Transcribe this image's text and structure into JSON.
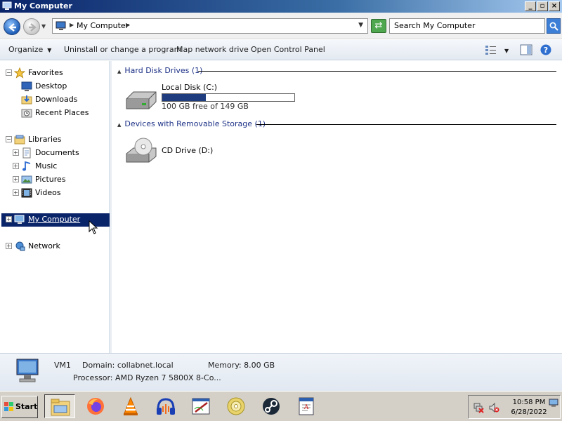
{
  "window": {
    "title": "My Computer"
  },
  "address_bar": {
    "path": "My Computer",
    "search_placeholder": "Search My Computer"
  },
  "toolbar": {
    "organize": "Organize",
    "uninstall": "Uninstall or change a program",
    "map_drive": "Map network drive",
    "control_panel": "Open Control Panel"
  },
  "nav": {
    "favorites": {
      "label": "Favorites",
      "items": [
        "Desktop",
        "Downloads",
        "Recent Places"
      ]
    },
    "libraries": {
      "label": "Libraries",
      "items": [
        "Documents",
        "Music",
        "Pictures",
        "Videos"
      ]
    },
    "my_computer": "My Computer",
    "network": "Network"
  },
  "content": {
    "groups": [
      {
        "header": "Hard Disk Drives (1)",
        "drives": [
          {
            "name": "Local Disk (C:)",
            "free_text": "100 GB free of 149 GB",
            "used_fraction": 0.33
          }
        ]
      },
      {
        "header": "Devices with Removable Storage (1)",
        "drives": [
          {
            "name": "CD Drive (D:)"
          }
        ]
      }
    ]
  },
  "details": {
    "name": "VM1",
    "domain": "Domain: collabnet.local",
    "memory": "Memory: 8.00 GB",
    "processor": "Processor: AMD Ryzen 7 5800X 8-Co..."
  },
  "taskbar": {
    "start": "Start",
    "apps": [
      "explorer-icon",
      "firefox-icon",
      "vlc-icon",
      "audacity-icon",
      "drawing-app-icon",
      "cd-icon",
      "steam-icon",
      "document-app-icon"
    ],
    "clock": {
      "time": "10:58 PM",
      "date": "6/28/2022"
    }
  },
  "colors": {
    "selection": "#0a246a",
    "title_gradient_start": "#0a246a",
    "capacity_fill": "#1e3c7e"
  }
}
